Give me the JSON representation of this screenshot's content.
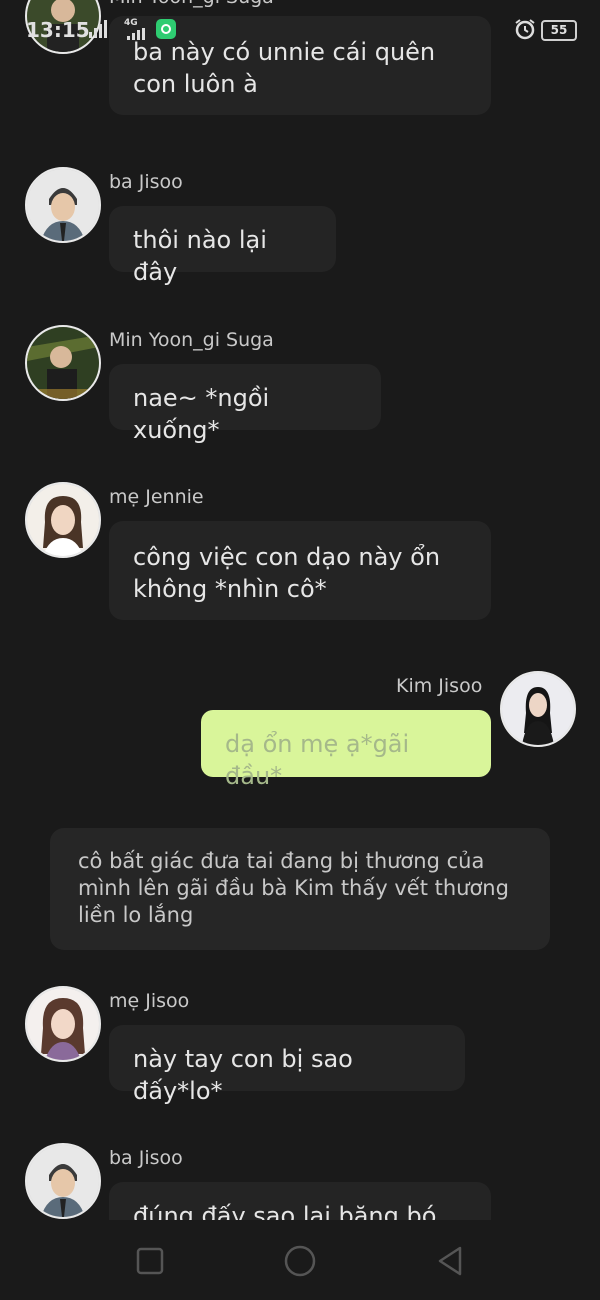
{
  "status_bar": {
    "time": "13:15",
    "network": "4G",
    "battery": "55"
  },
  "messages": [
    {
      "sender": "Min Yoon_gi Suga",
      "text": "ba này có unnie cái quên con luôn à"
    },
    {
      "sender": "ba Jisoo",
      "text": "thôi nào lại đây"
    },
    {
      "sender": "Min Yoon_gi Suga",
      "text": "nae~ *ngồi xuống*"
    },
    {
      "sender": "mẹ Jennie",
      "text": "công việc con dạo này ổn không *nhìn cô*"
    },
    {
      "sender": "Kim Jisoo",
      "text": "dạ ổn mẹ ạ*gãi đầu*"
    },
    {
      "narration": "cô bất giác đưa tai đang bị thương của mình lên gãi đầu bà Kim thấy vết thương liền lo lắng"
    },
    {
      "sender": "mẹ Jisoo",
      "text": "này tay con bị sao đấy*lo*"
    },
    {
      "sender": "ba Jisoo",
      "text": "đúng đấy sao lại băng bó"
    }
  ],
  "navbar": {
    "buttons": [
      "recents-button",
      "home-button",
      "back-button"
    ]
  }
}
